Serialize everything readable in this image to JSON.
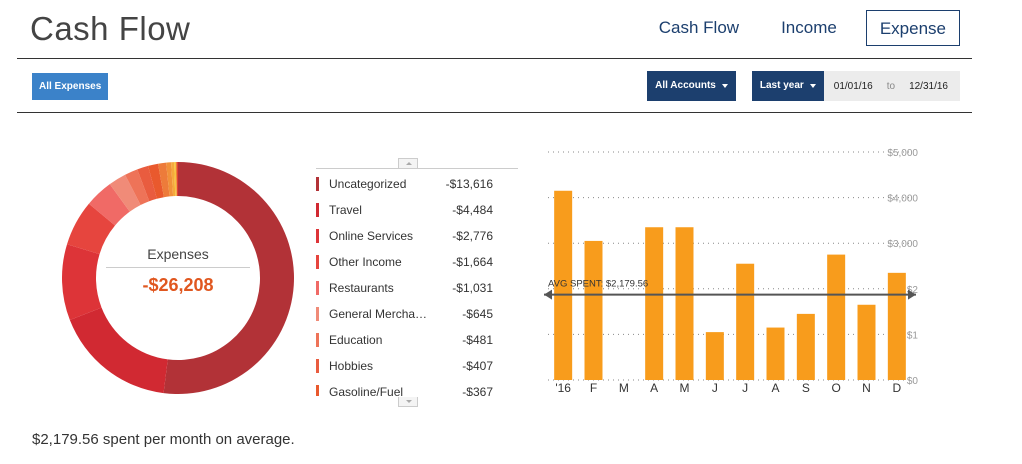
{
  "header": {
    "title": "Cash Flow",
    "nav": [
      {
        "label": "Cash Flow",
        "active": false
      },
      {
        "label": "Income",
        "active": false
      },
      {
        "label": "Expense",
        "active": true
      }
    ]
  },
  "toolbar": {
    "filter_label": "All Expenses",
    "accounts_label": "All Accounts",
    "period_label": "Last year",
    "date_from": "01/01/16",
    "date_to_sep": "to",
    "date_to": "12/31/16"
  },
  "donut": {
    "label": "Expenses",
    "total": "-$26,208"
  },
  "categories": [
    {
      "name": "Uncategorized",
      "amount": "-$13,616",
      "value": 13616,
      "color": "#b23237"
    },
    {
      "name": "Travel",
      "amount": "-$4,484",
      "value": 4484,
      "color": "#d12932"
    },
    {
      "name": "Online Services",
      "amount": "-$2,776",
      "value": 2776,
      "color": "#dd3438"
    },
    {
      "name": "Other Income",
      "amount": "-$1,664",
      "value": 1664,
      "color": "#e6453e"
    },
    {
      "name": "Restaurants",
      "amount": "-$1,031",
      "value": 1031,
      "color": "#f06a66"
    },
    {
      "name": "General Merchandise",
      "amount": "-$645",
      "value": 645,
      "color": "#f08b78"
    },
    {
      "name": "Education",
      "amount": "-$481",
      "value": 481,
      "color": "#ee7358"
    },
    {
      "name": "Hobbies",
      "amount": "-$407",
      "value": 407,
      "color": "#e95c3f"
    },
    {
      "name": "Gasoline/Fuel",
      "amount": "-$367",
      "value": 367,
      "color": "#e9592d"
    }
  ],
  "donut_extra_slices": [
    {
      "value": 290,
      "color": "#ed7b3a"
    },
    {
      "value": 180,
      "color": "#f1913a"
    },
    {
      "value": 110,
      "color": "#f5a93c"
    },
    {
      "value": 80,
      "color": "#f7c23f"
    },
    {
      "value": 60,
      "color": "#e2462f"
    }
  ],
  "chart_data": {
    "type": "bar",
    "categories": [
      "'16",
      "F",
      "M",
      "A",
      "M",
      "J",
      "J",
      "A",
      "S",
      "O",
      "N",
      "D"
    ],
    "values": [
      4150,
      3050,
      0,
      3350,
      3350,
      1050,
      2550,
      1150,
      1450,
      2750,
      1650,
      2350
    ],
    "ylim": [
      0,
      5000
    ],
    "yticks": [
      {
        "value": 5000,
        "label": "$5,000"
      },
      {
        "value": 4000,
        "label": "$4,000"
      },
      {
        "value": 3000,
        "label": "$3,000"
      },
      {
        "value": 2000,
        "label": "$2"
      },
      {
        "value": 1000,
        "label": "$1"
      },
      {
        "value": 0,
        "label": "$0"
      }
    ],
    "avg_value": 2179.56,
    "avg_label": "AVG SPENT: $2,179.56",
    "bar_color": "#f89c1c",
    "grid": true
  },
  "footer": {
    "avg_text": "$2,179.56 spent per month on average."
  }
}
